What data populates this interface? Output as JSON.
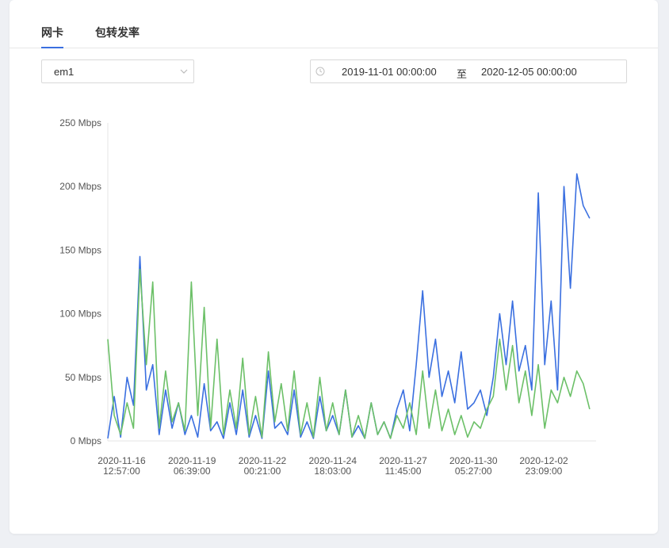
{
  "tabs": [
    {
      "label": "网卡",
      "active": true
    },
    {
      "label": "包转发率",
      "active": false
    }
  ],
  "interface_select": {
    "value": "em1"
  },
  "date_range": {
    "start": "2019-11-01 00:00:00",
    "separator": "至",
    "end": "2020-12-05 00:00:00"
  },
  "colors": {
    "accent": "#3a6fe0",
    "series_blue": "#3a6fe0",
    "series_green": "#6cc068"
  },
  "chart_data": {
    "type": "line",
    "y_unit": "Mbps",
    "ylim": [
      0,
      250
    ],
    "y_ticks": [
      {
        "value": 0,
        "label": "0 Mbps"
      },
      {
        "value": 50,
        "label": "50 Mbps"
      },
      {
        "value": 100,
        "label": "100 Mbps"
      },
      {
        "value": 150,
        "label": "150 Mbps"
      },
      {
        "value": 200,
        "label": "200 Mbps"
      },
      {
        "value": 250,
        "label": "250 Mbps"
      }
    ],
    "xlim": [
      "2020-11-16T00:00:00",
      "2020-12-05T00:00:00"
    ],
    "x_ticks": [
      {
        "date": "2020-11-16T12:57:00",
        "line1": "2020-11-16",
        "line2": "12:57:00"
      },
      {
        "date": "2020-11-19T06:39:00",
        "line1": "2020-11-19",
        "line2": "06:39:00"
      },
      {
        "date": "2020-11-22T00:21:00",
        "line1": "2020-11-22",
        "line2": "00:21:00"
      },
      {
        "date": "2020-11-24T18:03:00",
        "line1": "2020-11-24",
        "line2": "18:03:00"
      },
      {
        "date": "2020-11-27T11:45:00",
        "line1": "2020-11-27",
        "line2": "11:45:00"
      },
      {
        "date": "2020-11-30T05:27:00",
        "line1": "2020-11-30",
        "line2": "05:27:00"
      },
      {
        "date": "2020-12-02T23:09:00",
        "line1": "2020-12-02",
        "line2": "23:09:00"
      }
    ],
    "grid": false,
    "series": [
      {
        "color": "#3a6fe0",
        "x": [
          "2020-11-16T00:00:00",
          "2020-11-16T06:00:00",
          "2020-11-16T12:00:00",
          "2020-11-16T18:00:00",
          "2020-11-17T00:00:00",
          "2020-11-17T06:00:00",
          "2020-11-17T12:00:00",
          "2020-11-17T18:00:00",
          "2020-11-18T00:00:00",
          "2020-11-18T06:00:00",
          "2020-11-18T12:00:00",
          "2020-11-18T18:00:00",
          "2020-11-19T00:00:00",
          "2020-11-19T06:00:00",
          "2020-11-19T12:00:00",
          "2020-11-19T18:00:00",
          "2020-11-20T00:00:00",
          "2020-11-20T06:00:00",
          "2020-11-20T12:00:00",
          "2020-11-20T18:00:00",
          "2020-11-21T00:00:00",
          "2020-11-21T06:00:00",
          "2020-11-21T12:00:00",
          "2020-11-21T18:00:00",
          "2020-11-22T00:00:00",
          "2020-11-22T06:00:00",
          "2020-11-22T12:00:00",
          "2020-11-22T18:00:00",
          "2020-11-23T00:00:00",
          "2020-11-23T06:00:00",
          "2020-11-23T12:00:00",
          "2020-11-23T18:00:00",
          "2020-11-24T00:00:00",
          "2020-11-24T06:00:00",
          "2020-11-24T12:00:00",
          "2020-11-24T18:00:00",
          "2020-11-25T00:00:00",
          "2020-11-25T06:00:00",
          "2020-11-25T12:00:00",
          "2020-11-25T18:00:00",
          "2020-11-26T00:00:00",
          "2020-11-26T06:00:00",
          "2020-11-26T12:00:00",
          "2020-11-26T18:00:00",
          "2020-11-27T00:00:00",
          "2020-11-27T06:00:00",
          "2020-11-27T12:00:00",
          "2020-11-27T18:00:00",
          "2020-11-28T00:00:00",
          "2020-11-28T06:00:00",
          "2020-11-28T12:00:00",
          "2020-11-28T18:00:00",
          "2020-11-29T00:00:00",
          "2020-11-29T06:00:00",
          "2020-11-29T12:00:00",
          "2020-11-29T18:00:00",
          "2020-11-30T00:00:00",
          "2020-11-30T06:00:00",
          "2020-11-30T12:00:00",
          "2020-11-30T18:00:00",
          "2020-12-01T00:00:00",
          "2020-12-01T06:00:00",
          "2020-12-01T12:00:00",
          "2020-12-01T18:00:00",
          "2020-12-02T00:00:00",
          "2020-12-02T06:00:00",
          "2020-12-02T12:00:00",
          "2020-12-02T18:00:00",
          "2020-12-03T00:00:00",
          "2020-12-03T06:00:00",
          "2020-12-03T12:00:00",
          "2020-12-03T18:00:00",
          "2020-12-04T00:00:00",
          "2020-12-04T06:00:00",
          "2020-12-04T12:00:00",
          "2020-12-04T18:00:00"
        ],
        "values": [
          2,
          35,
          3,
          50,
          28,
          145,
          40,
          60,
          5,
          40,
          10,
          30,
          5,
          20,
          3,
          45,
          8,
          15,
          2,
          30,
          5,
          40,
          3,
          20,
          2,
          55,
          10,
          15,
          5,
          40,
          3,
          15,
          2,
          35,
          8,
          20,
          5,
          40,
          3,
          12,
          2,
          30,
          5,
          15,
          2,
          25,
          40,
          8,
          60,
          118,
          50,
          80,
          35,
          55,
          30,
          70,
          25,
          30,
          40,
          20,
          50,
          100,
          60,
          110,
          55,
          75,
          40,
          195,
          60,
          110,
          40,
          200,
          120,
          210,
          185,
          175
        ]
      },
      {
        "color": "#6cc068",
        "x": [
          "2020-11-16T00:00:00",
          "2020-11-16T06:00:00",
          "2020-11-16T12:00:00",
          "2020-11-16T18:00:00",
          "2020-11-17T00:00:00",
          "2020-11-17T06:00:00",
          "2020-11-17T12:00:00",
          "2020-11-17T18:00:00",
          "2020-11-18T00:00:00",
          "2020-11-18T06:00:00",
          "2020-11-18T12:00:00",
          "2020-11-18T18:00:00",
          "2020-11-19T00:00:00",
          "2020-11-19T06:00:00",
          "2020-11-19T12:00:00",
          "2020-11-19T18:00:00",
          "2020-11-20T00:00:00",
          "2020-11-20T06:00:00",
          "2020-11-20T12:00:00",
          "2020-11-20T18:00:00",
          "2020-11-21T00:00:00",
          "2020-11-21T06:00:00",
          "2020-11-21T12:00:00",
          "2020-11-21T18:00:00",
          "2020-11-22T00:00:00",
          "2020-11-22T06:00:00",
          "2020-11-22T12:00:00",
          "2020-11-22T18:00:00",
          "2020-11-23T00:00:00",
          "2020-11-23T06:00:00",
          "2020-11-23T12:00:00",
          "2020-11-23T18:00:00",
          "2020-11-24T00:00:00",
          "2020-11-24T06:00:00",
          "2020-11-24T12:00:00",
          "2020-11-24T18:00:00",
          "2020-11-25T00:00:00",
          "2020-11-25T06:00:00",
          "2020-11-25T12:00:00",
          "2020-11-25T18:00:00",
          "2020-11-26T00:00:00",
          "2020-11-26T06:00:00",
          "2020-11-26T12:00:00",
          "2020-11-26T18:00:00",
          "2020-11-27T00:00:00",
          "2020-11-27T06:00:00",
          "2020-11-27T12:00:00",
          "2020-11-27T18:00:00",
          "2020-11-28T00:00:00",
          "2020-11-28T06:00:00",
          "2020-11-28T12:00:00",
          "2020-11-28T18:00:00",
          "2020-11-29T00:00:00",
          "2020-11-29T06:00:00",
          "2020-11-29T12:00:00",
          "2020-11-29T18:00:00",
          "2020-11-30T00:00:00",
          "2020-11-30T06:00:00",
          "2020-11-30T12:00:00",
          "2020-11-30T18:00:00",
          "2020-12-01T00:00:00",
          "2020-12-01T06:00:00",
          "2020-12-01T12:00:00",
          "2020-12-01T18:00:00",
          "2020-12-02T00:00:00",
          "2020-12-02T06:00:00",
          "2020-12-02T12:00:00",
          "2020-12-02T18:00:00",
          "2020-12-03T00:00:00",
          "2020-12-03T06:00:00",
          "2020-12-03T12:00:00",
          "2020-12-03T18:00:00",
          "2020-12-04T00:00:00",
          "2020-12-04T06:00:00",
          "2020-12-04T12:00:00",
          "2020-12-04T18:00:00"
        ],
        "values": [
          80,
          20,
          5,
          30,
          10,
          135,
          60,
          125,
          10,
          55,
          15,
          30,
          8,
          125,
          20,
          105,
          10,
          80,
          5,
          40,
          10,
          65,
          5,
          35,
          3,
          70,
          15,
          45,
          8,
          55,
          5,
          30,
          3,
          50,
          8,
          30,
          5,
          40,
          3,
          20,
          2,
          30,
          5,
          15,
          2,
          20,
          10,
          30,
          5,
          55,
          10,
          40,
          8,
          25,
          5,
          20,
          3,
          15,
          10,
          25,
          35,
          80,
          40,
          75,
          30,
          55,
          20,
          60,
          10,
          40,
          30,
          50,
          35,
          55,
          45,
          25
        ]
      }
    ]
  }
}
